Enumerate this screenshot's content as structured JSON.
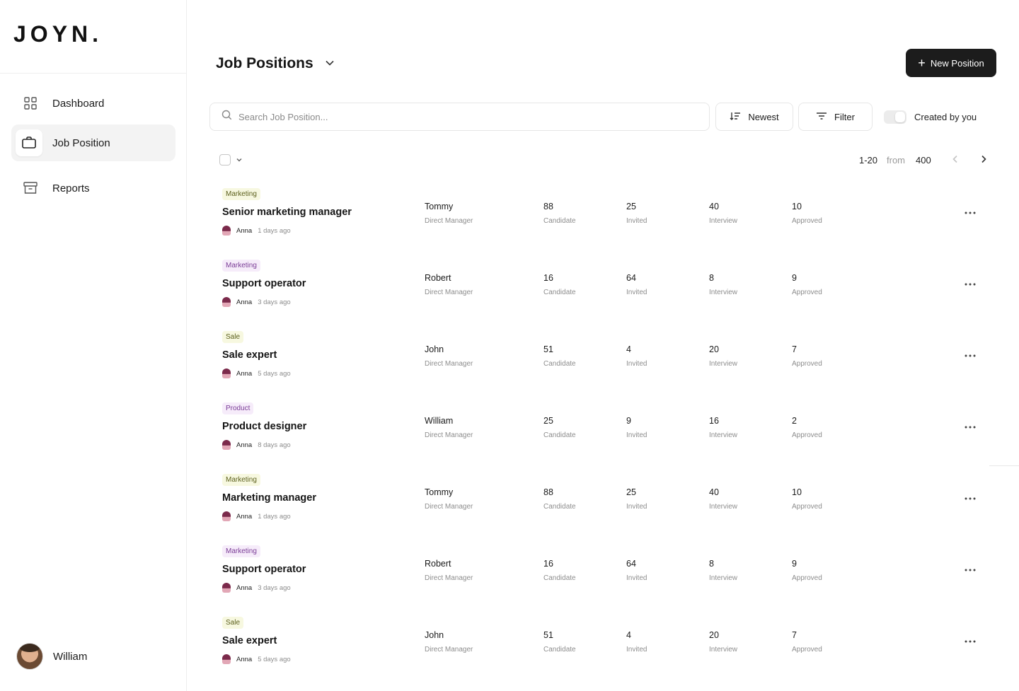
{
  "brand": {
    "logo": "JOYN."
  },
  "sidebar": {
    "items": [
      {
        "label": "Dashboard",
        "icon": "grid-icon",
        "active": false
      },
      {
        "label": "Job Position",
        "icon": "briefcase-icon",
        "active": true
      },
      {
        "label": "Reports",
        "icon": "archive-icon",
        "active": false
      }
    ],
    "user": {
      "name": "William"
    }
  },
  "header": {
    "title": "Job Positions",
    "new_button": "New Position"
  },
  "toolbar": {
    "search_placeholder": "Search Job Position...",
    "sort_label": "Newest",
    "filter_label": "Filter",
    "toggle_label": "Created by you",
    "toggle_on": false
  },
  "pagination": {
    "range": "1-20",
    "from": "from",
    "total": "400"
  },
  "labels": {
    "manager": "Direct Manager",
    "candidate": "Candidate",
    "invited": "Invited",
    "interview": "Interview",
    "approved": "Approved"
  },
  "positions": [
    {
      "tag": "Marketing",
      "tag_style": "marketing",
      "title": "Senior marketing manager",
      "author": "Anna",
      "ago": "1 days ago",
      "manager": "Tommy",
      "candidate": "88",
      "invited": "25",
      "interview": "40",
      "approved": "10"
    },
    {
      "tag": "Marketing",
      "tag_style": "marketing-p",
      "title": "Support operator",
      "author": "Anna",
      "ago": "3 days ago",
      "manager": "Robert",
      "candidate": "16",
      "invited": "64",
      "interview": "8",
      "approved": "9"
    },
    {
      "tag": "Sale",
      "tag_style": "sale",
      "title": "Sale expert",
      "author": "Anna",
      "ago": "5 days ago",
      "manager": "John",
      "candidate": "51",
      "invited": "4",
      "interview": "20",
      "approved": "7"
    },
    {
      "tag": "Product",
      "tag_style": "product",
      "title": "Product designer",
      "author": "Anna",
      "ago": "8 days ago",
      "manager": "William",
      "candidate": "25",
      "invited": "9",
      "interview": "16",
      "approved": "2"
    },
    {
      "tag": "Marketing",
      "tag_style": "marketing",
      "title": "Marketing manager",
      "author": "Anna",
      "ago": "1 days ago",
      "manager": "Tommy",
      "candidate": "88",
      "invited": "25",
      "interview": "40",
      "approved": "10"
    },
    {
      "tag": "Marketing",
      "tag_style": "marketing-p",
      "title": "Support operator",
      "author": "Anna",
      "ago": "3 days ago",
      "manager": "Robert",
      "candidate": "16",
      "invited": "64",
      "interview": "8",
      "approved": "9"
    },
    {
      "tag": "Sale",
      "tag_style": "sale",
      "title": "Sale expert",
      "author": "Anna",
      "ago": "5 days ago",
      "manager": "John",
      "candidate": "51",
      "invited": "4",
      "interview": "20",
      "approved": "7"
    }
  ],
  "colors": {
    "primary_button": "#1c1c1c",
    "active_nav_bg": "#f3f3f3",
    "tag_yellow_bg": "#f7f8e0",
    "tag_purple_bg": "#f6ecfa"
  }
}
